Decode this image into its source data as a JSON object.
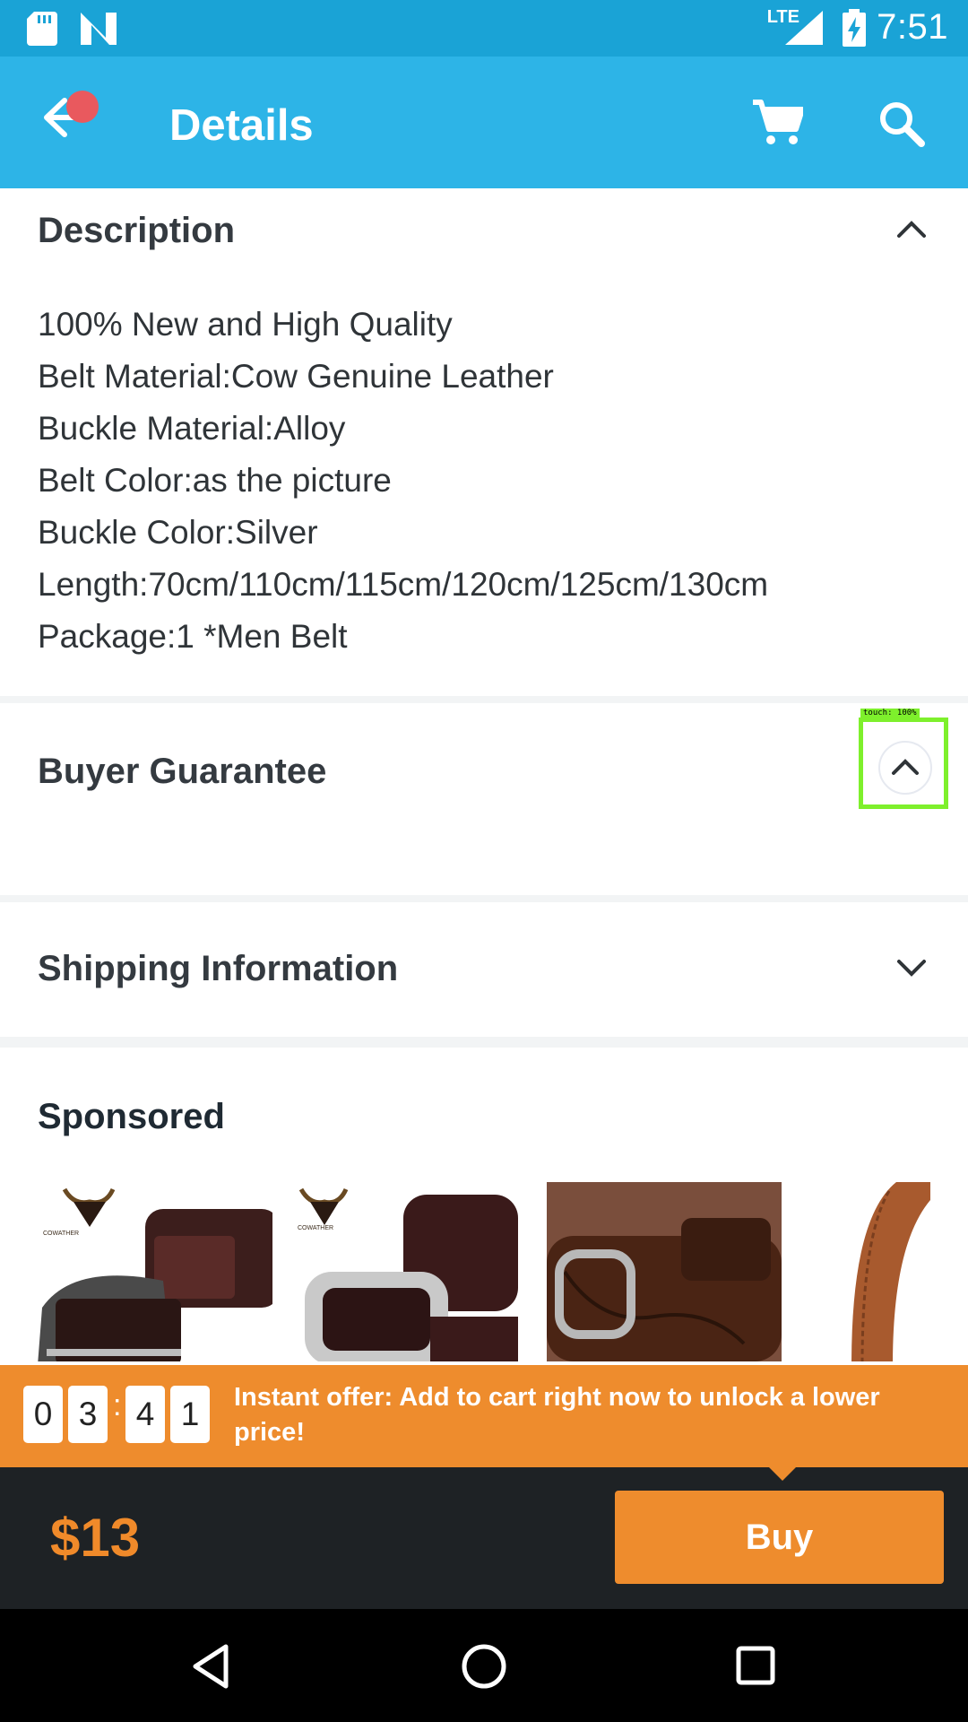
{
  "status_bar": {
    "time": "7:51",
    "network": "LTE",
    "icons": [
      "sd-card-icon",
      "notification-n-icon",
      "signal-icon",
      "battery-charging-icon"
    ]
  },
  "app_bar": {
    "title": "Details",
    "back_icon": "arrow-left-icon",
    "cart_icon": "cart-icon",
    "search_icon": "search-icon"
  },
  "description": {
    "title": "Description",
    "lines": [
      "100% New and High Quality",
      "Belt Material:Cow Genuine Leather",
      "Buckle Material:Alloy",
      "Belt Color:as the picture",
      "Buckle Color:Silver",
      "Length:70cm/110cm/115cm/120cm/125cm/130cm",
      "Package:1 *Men Belt"
    ]
  },
  "buyer_guarantee": {
    "title": "Buyer Guarantee"
  },
  "shipping": {
    "title": "Shipping Information"
  },
  "sponsored": {
    "title": "Sponsored",
    "brand_logo_text": "COWATHER"
  },
  "offer": {
    "timer_digits": [
      "0",
      "3",
      "4",
      "1"
    ],
    "separator": ":",
    "text": "Instant offer: Add to cart right now to unlock a lower price!"
  },
  "purchase": {
    "price": "$13",
    "buy_label": "Buy"
  },
  "touch_overlay": {
    "label": "touch: 100%"
  },
  "colors": {
    "status_bar": "#1aa3d6",
    "app_bar": "#2db4e7",
    "accent_orange": "#ee8c2d",
    "dark_bar": "#1e2225"
  }
}
